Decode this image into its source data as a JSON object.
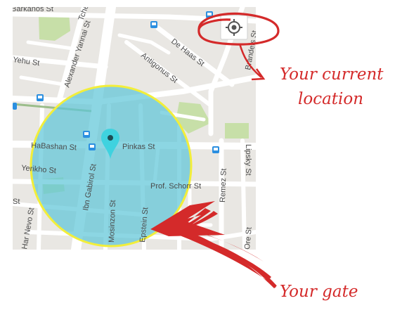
{
  "map": {
    "streets": {
      "s_arkanos": "Barkanos St",
      "s_tchernichovski": "Tchernichovski St",
      "s_yehu": "Yehu St",
      "s_alexander_yannai": "Alexander Yannai St",
      "s_de_haas": "De Haas St",
      "s_antigonus": "Antigonus St",
      "s_brandeis": "Brandeis St",
      "s_habashan": "HaBashan St",
      "s_pinkas": "Pinkas St",
      "s_lipsky": "Lipsky St",
      "s_yerikho": "Yerikho St",
      "s_ibn_gabirol": "Ibn Gabirol St",
      "s_prof_schorr": "Prof. Schorr St",
      "s_remez": "Remez St",
      "s_mosinzon": "Mosinzon St",
      "s_epstein": "Epstein St",
      "s_har_nevo": "Har Nevo St",
      "s_ore": "Ore St"
    },
    "colors": {
      "map_background": "#e9e7e3",
      "street": "#ffffff",
      "park": "#c7dfa8",
      "gate_fill": "#5fc6d8",
      "gate_stroke": "#f2ee3a",
      "pin": "#3fd2df",
      "transit_badge": "#2b8fe0",
      "annotation": "#d42a2a"
    },
    "my_location_icon": "crosshair-icon",
    "pin_icon": "map-pin-icon",
    "transit_icon": "bus-stop-icon"
  },
  "annotations": {
    "current_location_line1": "Your current",
    "current_location_line2": "location",
    "gate": "Your gate"
  }
}
